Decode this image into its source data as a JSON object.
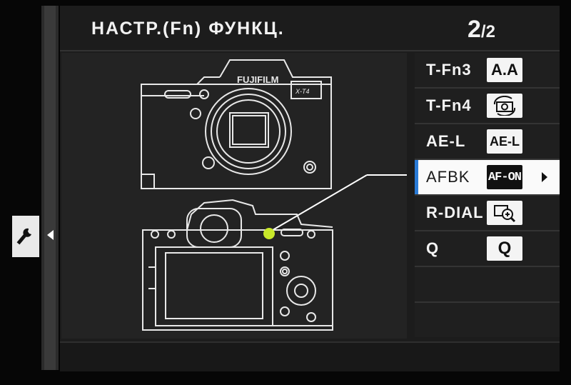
{
  "header": {
    "title": "НАСТР.(Fn) ФУНКЦ.",
    "page_current": "2",
    "page_total": "/2"
  },
  "camera": {
    "brand": "FUJIFILM",
    "model": "X-T4"
  },
  "menu": {
    "items": [
      {
        "label": "T-Fn3",
        "icon": "A.A",
        "icon_name": "auto-metering-icon"
      },
      {
        "label": "T-Fn4",
        "icon": "",
        "icon_name": "rotate-camera-icon"
      },
      {
        "label": "AE-L",
        "icon": "AE-L",
        "icon_name": "ae-lock-icon"
      },
      {
        "label": "AFBK",
        "icon": "AF-ON",
        "icon_name": "af-on-icon"
      },
      {
        "label": "R-DIAL",
        "icon": "",
        "icon_name": "zoom-in-icon"
      },
      {
        "label": "Q",
        "icon": "Q",
        "icon_name": "quick-menu-icon"
      }
    ],
    "selected_index": 3
  },
  "colors": {
    "accent": "#2a7bd6",
    "highlight_dot": "#c8e82a"
  }
}
